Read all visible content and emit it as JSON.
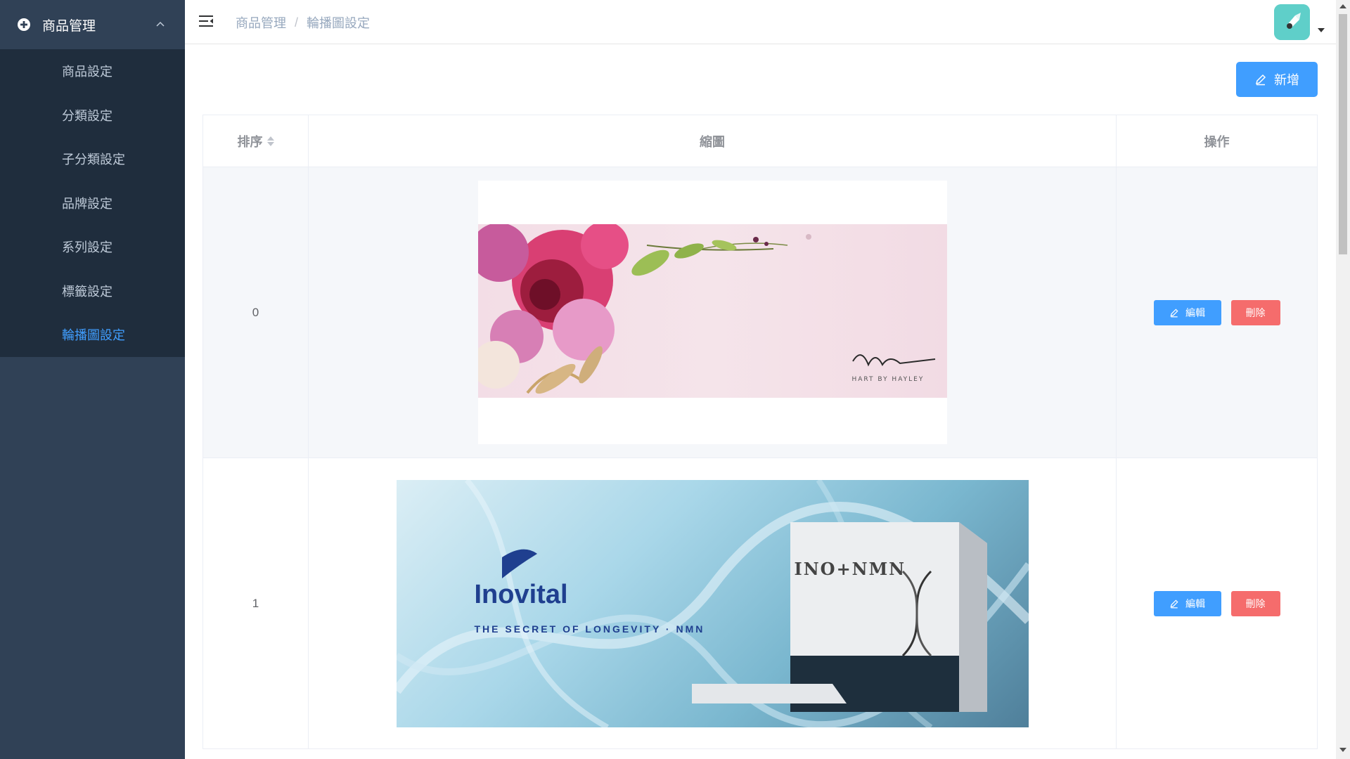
{
  "sidebar": {
    "group_label": "商品管理",
    "items": [
      {
        "label": "商品設定"
      },
      {
        "label": "分類設定"
      },
      {
        "label": "子分類設定"
      },
      {
        "label": "品牌設定"
      },
      {
        "label": "系列設定"
      },
      {
        "label": "標籤設定"
      },
      {
        "label": "輪播圖設定",
        "active": true
      }
    ]
  },
  "header": {
    "breadcrumb": [
      "商品管理",
      "輪播圖設定"
    ],
    "breadcrumb_separator": "/"
  },
  "toolbar": {
    "add_label": "新增"
  },
  "table": {
    "headers": {
      "order": "排序",
      "thumb": "縮圖",
      "actions": "操作"
    },
    "rows": [
      {
        "order": "0",
        "edit_label": "編輯",
        "delete_label": "刪除",
        "banner_caption": "HART BY HAYLEY"
      },
      {
        "order": "1",
        "edit_label": "編輯",
        "delete_label": "刪除",
        "banner_brand": "Inovital",
        "banner_tagline": "THE SECRET OF LONGEVITY · NMN",
        "banner_product": "INO+NMN"
      }
    ]
  },
  "colors": {
    "primary": "#409eff",
    "danger": "#f56c6c",
    "sidebar_bg": "#304156",
    "submenu_bg": "#1f2d3d",
    "active_text": "#409eff"
  }
}
